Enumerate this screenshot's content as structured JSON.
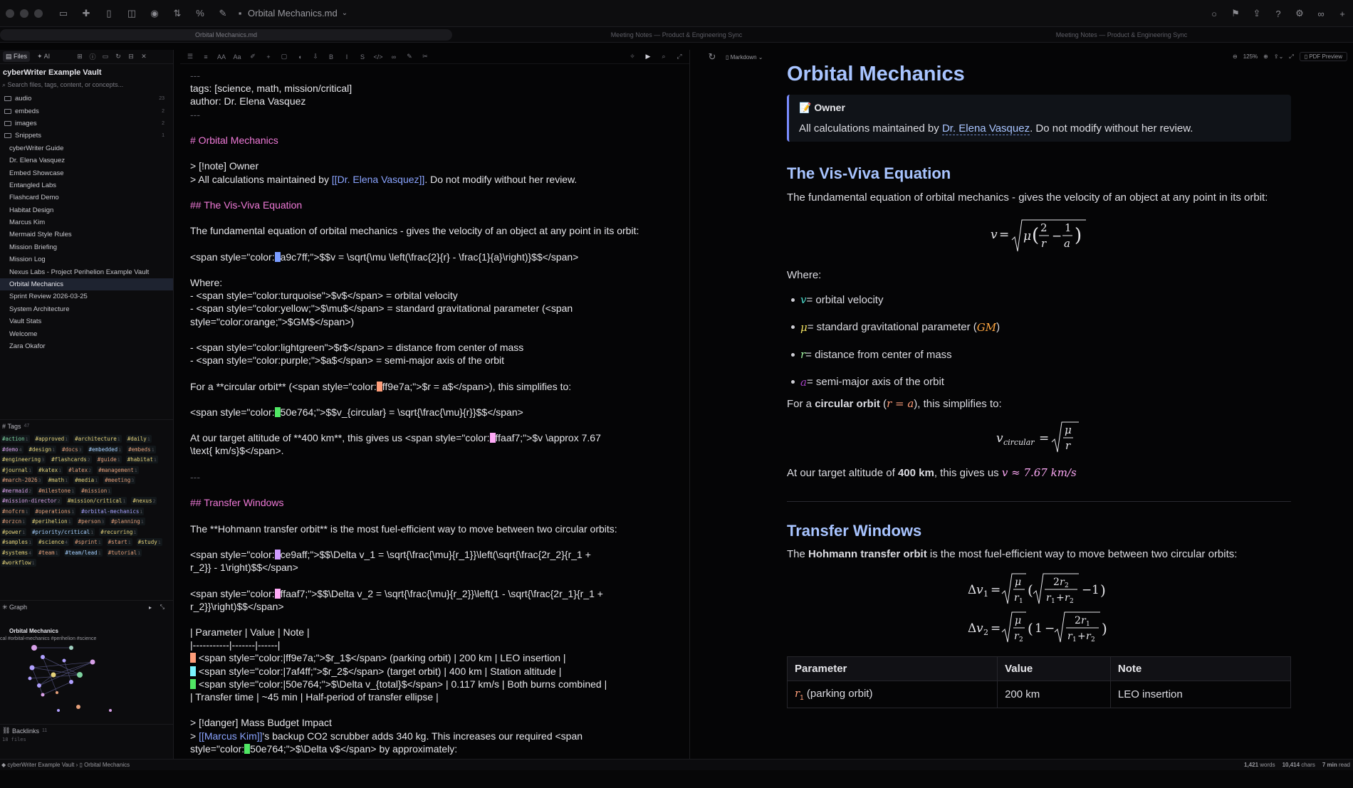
{
  "window": {
    "doc_title": "Orbital Mechanics.md"
  },
  "tabs": [
    "Orbital Mechanics.md",
    "Meeting Notes — Product & Engineering Sync",
    "Meeting Notes — Product & Engineering Sync"
  ],
  "sidebar": {
    "tab_files": "Files",
    "tab_ai": "AI",
    "vault_name": "cyberWriter Example Vault",
    "search_placeholder": "Search files, tags, content, or concepts...",
    "folders": [
      {
        "label": "audio",
        "count": "23"
      },
      {
        "label": "embeds",
        "count": "2"
      },
      {
        "label": "images",
        "count": "2"
      },
      {
        "label": "Snippets",
        "count": "1"
      }
    ],
    "files": [
      "cyberWriter Guide",
      "Dr. Elena Vasquez",
      "Embed Showcase",
      "Entangled Labs",
      "Flashcard Demo",
      "Habitat Design",
      "Marcus Kim",
      "Mermaid Style Rules",
      "Mission Briefing",
      "Mission Log",
      "Nexus Labs - Project Perihelion Example Vault",
      "Orbital Mechanics",
      "Sprint Review 2026-03-25",
      "System Architecture",
      "Vault Stats",
      "Welcome",
      "Zara Okafor"
    ],
    "active_file": "Orbital Mechanics",
    "tags_header": "Tags",
    "tags_count": "47",
    "tags": [
      {
        "t": "#action",
        "n": "1",
        "c": "#7ed3a0"
      },
      {
        "t": "#approved",
        "n": "1",
        "c": "#e6d27a"
      },
      {
        "t": "#architecture",
        "n": "1",
        "c": "#e6d27a"
      },
      {
        "t": "#daily",
        "n": "1",
        "c": "#e6d27a"
      },
      {
        "t": "#demo",
        "n": "4",
        "c": "#d8a0e8"
      },
      {
        "t": "#design",
        "n": "1",
        "c": "#e6d27a"
      },
      {
        "t": "#docs",
        "n": "3",
        "c": "#e6a07a"
      },
      {
        "t": "#embedded",
        "n": "1",
        "c": "#a8d0ff"
      },
      {
        "t": "#embeds",
        "n": "1",
        "c": "#e6a07a"
      },
      {
        "t": "#engineering",
        "n": "3",
        "c": "#e6d27a"
      },
      {
        "t": "#flashcards",
        "n": "2",
        "c": "#e6d27a"
      },
      {
        "t": "#guide",
        "n": "1",
        "c": "#e6a07a"
      },
      {
        "t": "#habitat",
        "n": "1",
        "c": "#e6d27a"
      },
      {
        "t": "#journal",
        "n": "1",
        "c": "#e6d27a"
      },
      {
        "t": "#katex",
        "n": "1",
        "c": "#e6d27a"
      },
      {
        "t": "#latex",
        "n": "2",
        "c": "#e6a07a"
      },
      {
        "t": "#management",
        "n": "1",
        "c": "#e6a07a"
      },
      {
        "t": "#march-2026",
        "n": "3",
        "c": "#e6a07a"
      },
      {
        "t": "#math",
        "n": "1",
        "c": "#e6d27a"
      },
      {
        "t": "#media",
        "n": "1",
        "c": "#e6d27a"
      },
      {
        "t": "#meeting",
        "n": "3",
        "c": "#e6a07a"
      },
      {
        "t": "#mermaid",
        "n": "2",
        "c": "#d8a0e8"
      },
      {
        "t": "#milestone",
        "n": "1",
        "c": "#e6a07a"
      },
      {
        "t": "#mission",
        "n": "1",
        "c": "#e6a07a"
      },
      {
        "t": "#mission-director",
        "n": "2",
        "c": "#d8a0e8"
      },
      {
        "t": "#mission/critical",
        "n": "1",
        "c": "#e6d27a"
      },
      {
        "t": "#nexus",
        "n": "2",
        "c": "#e6d27a"
      },
      {
        "t": "#nofcrn",
        "n": "1",
        "c": "#e6a07a"
      },
      {
        "t": "#operations",
        "n": "1",
        "c": "#e6a07a"
      },
      {
        "t": "#orbital-mechanics",
        "n": "1",
        "c": "#a8a0ff"
      },
      {
        "t": "#orzcn",
        "n": "1",
        "c": "#e6a07a"
      },
      {
        "t": "#perihelion",
        "n": "1",
        "c": "#e6d27a"
      },
      {
        "t": "#person",
        "n": "3",
        "c": "#e6a07a"
      },
      {
        "t": "#planning",
        "n": "1",
        "c": "#e6a07a"
      },
      {
        "t": "#power",
        "n": "1",
        "c": "#e6d27a"
      },
      {
        "t": "#priority/critical",
        "n": "1",
        "c": "#a8d0ff"
      },
      {
        "t": "#recurring",
        "n": "1",
        "c": "#e6d27a"
      },
      {
        "t": "#samples",
        "n": "1",
        "c": "#e6d27a"
      },
      {
        "t": "#science",
        "n": "4",
        "c": "#e6d27a"
      },
      {
        "t": "#sprint",
        "n": "1",
        "c": "#e6a07a"
      },
      {
        "t": "#start",
        "n": "1",
        "c": "#e6a07a"
      },
      {
        "t": "#study",
        "n": "1",
        "c": "#e6d27a"
      },
      {
        "t": "#systems",
        "n": "4",
        "c": "#e6d27a"
      },
      {
        "t": "#team",
        "n": "1",
        "c": "#e6a07a"
      },
      {
        "t": "#team/lead",
        "n": "1",
        "c": "#a8d0ff"
      },
      {
        "t": "#tutorial",
        "n": "1",
        "c": "#e6a07a"
      },
      {
        "t": "#workflow",
        "n": "1",
        "c": "#e6d27a"
      }
    ],
    "graph_header": "Graph",
    "graph_title": "Orbital Mechanics",
    "graph_sub": "cal #orbital-mechanics #perihelion #science",
    "backlinks_header": "Backlinks",
    "backlinks_count": "11",
    "backlinks_files": "18 files"
  },
  "editor": {
    "preview_mode": "Markdown"
  },
  "editor_lines": [
    {
      "t": "---",
      "k": "m"
    },
    {
      "t": "tags: [science, math, mission/critical]",
      "k": "n"
    },
    {
      "t": "author: Dr. Elena Vasquez",
      "k": "n"
    },
    {
      "t": "---",
      "k": "m"
    },
    {
      "t": "",
      "k": "n"
    },
    {
      "t": "# Orbital Mechanics",
      "k": "h"
    },
    {
      "t": "",
      "k": "n"
    },
    {
      "t": "> [!note] Owner",
      "k": "n"
    },
    {
      "t": "> All calculations maintained by [[Dr. Elena Vasquez]]. Do not modify without her review.",
      "k": "q"
    },
    {
      "t": "",
      "k": "n"
    },
    {
      "t": "## The Vis-Viva Equation",
      "k": "h"
    },
    {
      "t": "",
      "k": "n"
    },
    {
      "t": "The fundamental equation of orbital mechanics - gives the velocity of an object at any point in its orbit:",
      "k": "n"
    },
    {
      "t": "",
      "k": "n"
    },
    {
      "t": "<span style=\"color:|a9c7ff;\">$$v = \\sqrt{\\mu \\left(\\frac{2}{r} - \\frac{1}{a}\\right)}$$</span>",
      "k": "s",
      "sw": "#7a9cff"
    },
    {
      "t": "",
      "k": "n"
    },
    {
      "t": "Where:",
      "k": "n"
    },
    {
      "t": "- <span style=\"color:turquoise\">$v$</span> = orbital velocity",
      "k": "n"
    },
    {
      "t": "- <span style=\"color:yellow;\">$\\mu$</span> = standard gravitational parameter (<span",
      "k": "n"
    },
    {
      "t": "style=\"color:orange;\">$GM$</span>)",
      "k": "n"
    },
    {
      "t": "",
      "k": "n"
    },
    {
      "t": "- <span style=\"color:lightgreen\">$r$</span> = distance from center of mass",
      "k": "n"
    },
    {
      "t": "- <span style=\"color:purple;\">$a$</span> = semi-major axis of the orbit",
      "k": "n"
    },
    {
      "t": "",
      "k": "n"
    },
    {
      "t": "For a **circular orbit** (<span style=\"color:|ff9e7a;\">$r = a$</span>), this simplifies to:",
      "k": "s",
      "sw": "#ff9e7a"
    },
    {
      "t": "",
      "k": "n"
    },
    {
      "t": "<span style=\"color:|50e764;\">$$v_{circular} = \\sqrt{\\frac{\\mu}{r}}$$</span>",
      "k": "s",
      "sw": "#50e764"
    },
    {
      "t": "",
      "k": "n"
    },
    {
      "t": "At our target altitude of **400 km**, this gives us <span style=\"color:|ffaaf7;\">$v \\approx 7.67",
      "k": "s",
      "sw": "#ffaaf7"
    },
    {
      "t": "\\text{ km/s}$</span>.",
      "k": "n"
    },
    {
      "t": "",
      "k": "n"
    },
    {
      "t": "---",
      "k": "m"
    },
    {
      "t": "",
      "k": "n"
    },
    {
      "t": "## Transfer Windows",
      "k": "h"
    },
    {
      "t": "",
      "k": "n"
    },
    {
      "t": "The **Hohmann transfer orbit** is the most fuel-efficient way to move between two circular orbits:",
      "k": "n"
    },
    {
      "t": "",
      "k": "n"
    },
    {
      "t": "<span style=\"color:|ce9aff;\">$$\\Delta v_1 = \\sqrt{\\frac{\\mu}{r_1}}\\left(\\sqrt{\\frac{2r_2}{r_1 +",
      "k": "s",
      "sw": "#ce9aff"
    },
    {
      "t": "r_2}} - 1\\right)$$</span>",
      "k": "n"
    },
    {
      "t": "",
      "k": "n"
    },
    {
      "t": "<span style=\"color:|ffaaf7;\">$$\\Delta v_2 = \\sqrt{\\frac{\\mu}{r_2}}\\left(1 - \\sqrt{\\frac{2r_1}{r_1 +",
      "k": "s",
      "sw": "#ffaaf7"
    },
    {
      "t": "r_2}}\\right)$$</span>",
      "k": "n"
    },
    {
      "t": "",
      "k": "n"
    },
    {
      "t": "| Parameter | Value | Note |",
      "k": "n"
    },
    {
      "t": "|-----------|-------|------|",
      "k": "n"
    },
    {
      "t": "| <span style=\"color:|ff9e7a;\">$r_1$</span> (parking orbit) | 200 km | LEO insertion |",
      "k": "s",
      "sw": "#ff9e7a"
    },
    {
      "t": "| <span style=\"color:|7af4ff;\">$r_2$</span> (target orbit) | 400 km | Station altitude |",
      "k": "s",
      "sw": "#7af4ff"
    },
    {
      "t": "| <span style=\"color:|50e764;\">$\\Delta v_{total}$</span> | 0.117 km/s | Both burns combined |",
      "k": "s",
      "sw": "#50e764"
    },
    {
      "t": "| Transfer time | ~45 min | Half-period of transfer ellipse |",
      "k": "n"
    },
    {
      "t": "",
      "k": "n"
    },
    {
      "t": "> [!danger] Mass Budget Impact",
      "k": "n"
    },
    {
      "t": "> [[Marcus Kim]]'s backup CO2 scrubber adds 340 kg. This increases our required <span",
      "k": "q2"
    },
    {
      "t": "style=\"color:|50e764;\">$\\Delta v$</span> by approximately:",
      "k": "s",
      "sw": "#50e764"
    }
  ],
  "preview": {
    "zoom": "125%",
    "pdf": "PDF Preview",
    "h1": "Orbital Mechanics",
    "callout_title": "Owner",
    "callout_pre": "All calculations maintained by ",
    "callout_link": "Dr. Elena Vasquez",
    "callout_post": ". Do not modify without her review.",
    "h2_visviva": "The Vis-Viva Equation",
    "p_fund": "The fundamental equation of orbital mechanics - gives the velocity of an object at any point in its orbit:",
    "where": "Where:",
    "list": [
      {
        "sym": "v",
        "c": "#4fe0d0",
        "txt": " = orbital velocity"
      },
      {
        "sym": "μ",
        "c": "#f0e060",
        "txt": " = standard gravitational parameter (",
        "extra": "GM",
        "extra_c": "#ffa640",
        "tail": ")"
      },
      {
        "sym": "r",
        "c": "#a0f0a0",
        "txt": " = distance from center of mass"
      },
      {
        "sym": "a",
        "c": "#a040c0",
        "txt": " = semi-major axis of the orbit"
      }
    ],
    "circ_pre": "For a ",
    "circ_bold": "circular orbit",
    "circ_mid": " (",
    "circ_math": "r = a",
    "circ_post": "), this simplifies to:",
    "alt_pre": "At our target altitude of ",
    "alt_bold": "400 km",
    "alt_mid": ", this gives us ",
    "alt_math": "v ≈ 7.67 km/s",
    "h2_transfer": "Transfer Windows",
    "hoh_pre": "The ",
    "hoh_bold": "Hohmann transfer orbit",
    "hoh_post": " is the most fuel-efficient way to move between two circular orbits:",
    "table_headers": [
      "Parameter",
      "Value",
      "Note"
    ],
    "table_row1": {
      "sym": "r",
      "sub": "1",
      "label": " (parking orbit)",
      "value": "200 km",
      "note": "LEO insertion"
    }
  },
  "status": {
    "vault": "cyberWriter Example Vault",
    "file": "Orbital Mechanics",
    "words": "1,421",
    "chars": "10,414",
    "read": "7 min"
  }
}
